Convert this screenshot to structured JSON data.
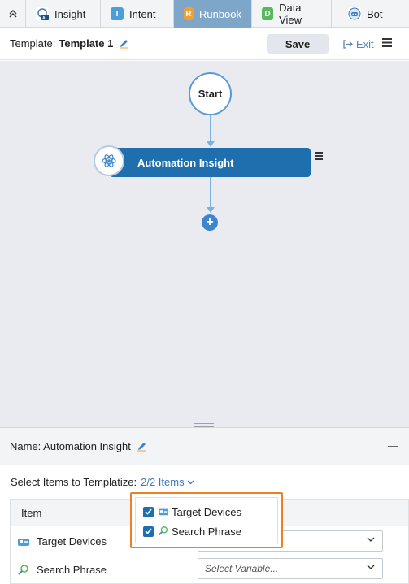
{
  "tabs": [
    {
      "label": "Insight",
      "icon": "insight-ai-icon",
      "active": false
    },
    {
      "label": "Intent",
      "icon": "intent-icon",
      "active": false
    },
    {
      "label": "Runbook",
      "icon": "runbook-icon",
      "active": true
    },
    {
      "label": "Data View",
      "icon": "data-view-icon",
      "active": false
    },
    {
      "label": "Bot",
      "icon": "bot-icon",
      "active": false
    }
  ],
  "tab_letters": {
    "intent": "I",
    "runbook": "R",
    "data_view": "D"
  },
  "template": {
    "label": "Template:",
    "name": "Template 1",
    "save_label": "Save",
    "exit_label": "Exit"
  },
  "canvas": {
    "start_label": "Start",
    "node_label": "Automation Insight",
    "add_symbol": "+"
  },
  "props": {
    "name_label": "Name: Automation Insight",
    "select_label": "Select Items to Templatize:",
    "items_count": "2/2 Items",
    "table": {
      "header": "Item",
      "rows": [
        {
          "label": "Target Devices",
          "icon": "target-devices-icon",
          "variable": ""
        },
        {
          "label": "Search Phrase",
          "icon": "search-phrase-icon",
          "variable": "Select Variable..."
        }
      ]
    },
    "popup_items": [
      {
        "label": "Target Devices",
        "checked": true
      },
      {
        "label": "Search Phrase",
        "checked": true
      }
    ]
  },
  "colors": {
    "accent": "#1f6fae",
    "tab_active": "#7ea6c8",
    "highlight": "#f07f22",
    "link": "#3d7ab8"
  }
}
